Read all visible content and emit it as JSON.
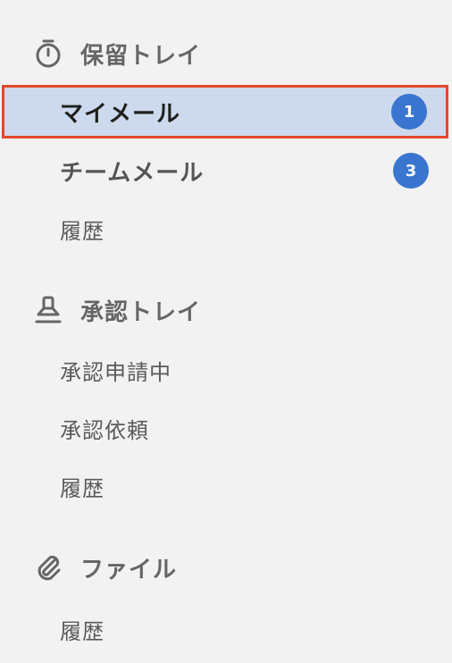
{
  "colors": {
    "background": "#f2f2f2",
    "selected_background": "#cdd9ec",
    "selected_border": "#e4472b",
    "badge": "#3a76cf"
  },
  "sections": [
    {
      "title": "保留トレイ",
      "icon": "timer-icon",
      "items": [
        {
          "label": "マイメール",
          "badge": "1",
          "selected": true
        },
        {
          "label": "チームメール",
          "badge": "3"
        },
        {
          "label": "履歴"
        }
      ]
    },
    {
      "title": "承認トレイ",
      "icon": "stamp-icon",
      "items": [
        {
          "label": "承認申請中"
        },
        {
          "label": "承認依頼"
        },
        {
          "label": "履歴"
        }
      ]
    },
    {
      "title": "ファイル",
      "icon": "paperclip-icon",
      "items": [
        {
          "label": "履歴"
        }
      ]
    }
  ]
}
